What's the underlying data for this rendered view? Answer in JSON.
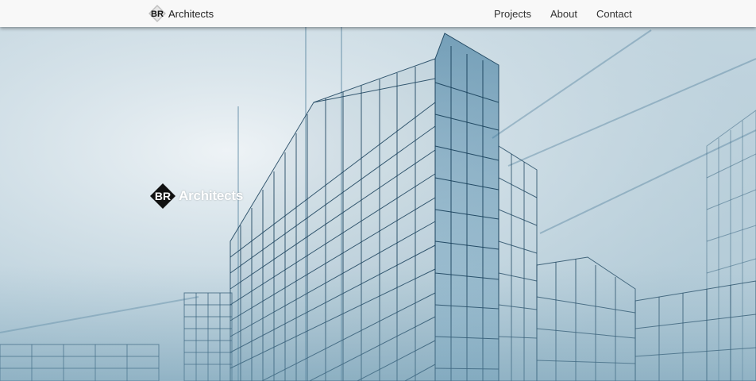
{
  "navbar": {
    "brand": {
      "logo_text": "BR",
      "name": "Architects",
      "logo_icon": "br-diamond-logo"
    },
    "links": [
      {
        "label": "Projects"
      },
      {
        "label": "About"
      },
      {
        "label": "Contact"
      }
    ]
  },
  "hero": {
    "logo_text": "BR",
    "title": "Architects",
    "background": "wireframe-building-blueprint-image"
  },
  "colors": {
    "navbar_bg": "#f8f8f8",
    "hero_text": "#ffffff",
    "wireframe_lines": "#1f4a66",
    "sky": "#c8dae3"
  }
}
